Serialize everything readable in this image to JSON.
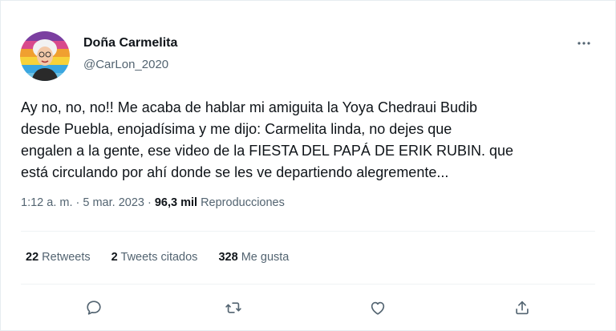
{
  "author": {
    "display_name": "Doña Carmelita",
    "handle": "@CarLon_2020"
  },
  "tweet": {
    "text": "Ay no, no, no!! Me acaba de hablar mi amiguita la Yoya Chedraui Budib\ndesde Puebla, enojadísima y me dijo: Carmelita linda, no dejes que\nengalen a la gente, ese video de la FIESTA DEL PAPÁ DE ERIK RUBIN. que\nestá circulando por ahí donde se les ve departiendo alegremente..."
  },
  "meta": {
    "time": "1:12 a. m.",
    "sep1": " · ",
    "date": "5 mar. 2023",
    "sep2": " · ",
    "views_count": "96,3 mil",
    "views_label": "Reproducciones"
  },
  "stats": {
    "retweets_count": "22",
    "retweets_label": "Retweets",
    "quotes_count": "2",
    "quotes_label": "Tweets citados",
    "likes_count": "328",
    "likes_label": "Me gusta"
  },
  "icons": {
    "more": "more-dots-icon",
    "reply": "reply-icon",
    "retweet": "retweet-icon",
    "like": "like-icon",
    "share": "share-icon"
  },
  "colors": {
    "text": "#0f1419",
    "secondary": "#536471",
    "divider": "#eff3f4"
  }
}
